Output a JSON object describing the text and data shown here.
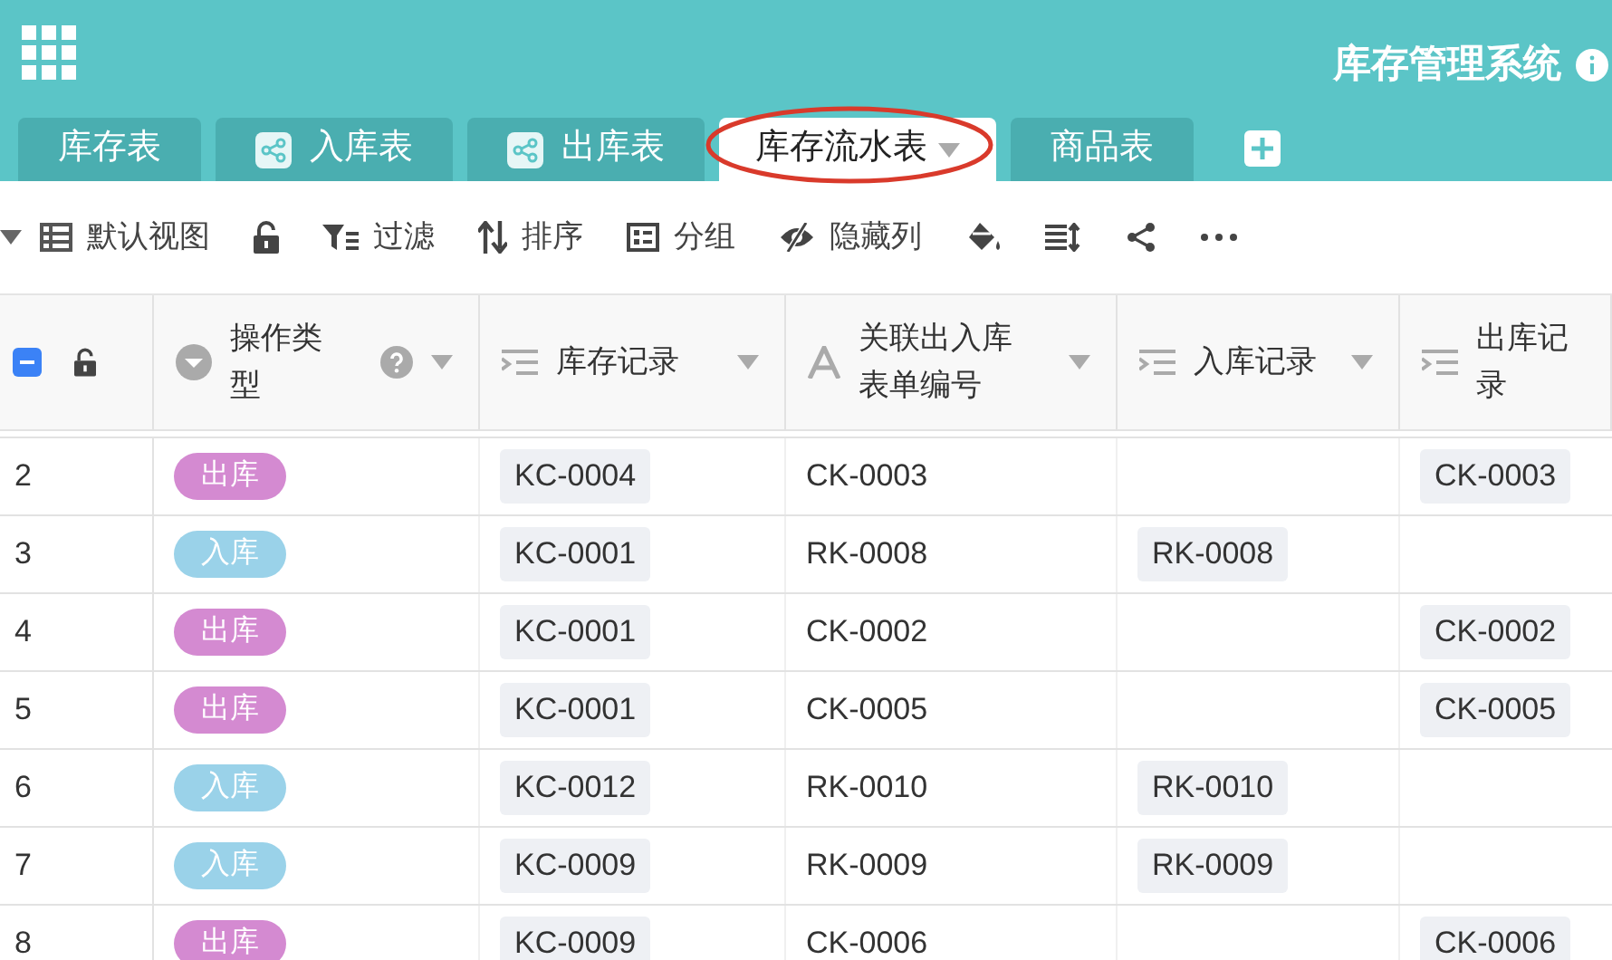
{
  "app": {
    "title": "库存管理系统"
  },
  "tabs": [
    {
      "label": "库存表",
      "linked": false,
      "selected": false
    },
    {
      "label": "入库表",
      "linked": true,
      "selected": false
    },
    {
      "label": "出库表",
      "linked": true,
      "selected": false
    },
    {
      "label": "库存流水表",
      "linked": false,
      "selected": true
    },
    {
      "label": "商品表",
      "linked": false,
      "selected": false
    }
  ],
  "toolbar": [
    {
      "kind": "view",
      "label": "默认视图"
    },
    {
      "kind": "lock"
    },
    {
      "kind": "filter",
      "label": "过滤"
    },
    {
      "kind": "sort",
      "label": "排序"
    },
    {
      "kind": "group",
      "label": "分组"
    },
    {
      "kind": "hide",
      "label": "隐藏列"
    },
    {
      "kind": "fill"
    },
    {
      "kind": "rowheight"
    },
    {
      "kind": "share"
    },
    {
      "kind": "more"
    }
  ],
  "select_all": {
    "indeterminate": true
  },
  "columns": [
    {
      "label": "操作类型",
      "kind": "select",
      "help": true
    },
    {
      "label": "库存记录",
      "kind": "link",
      "help": false
    },
    {
      "label": "关联出入库表单编号",
      "kind": "text",
      "help": false
    },
    {
      "label": "入库记录",
      "kind": "link",
      "help": false
    },
    {
      "label": "出库记录",
      "kind": "link",
      "help": false
    }
  ],
  "rows": [
    {
      "index": "2",
      "type": {
        "label": "出库",
        "color": "#d48ad1"
      },
      "stock": "KC-0004",
      "related": "CK-0003",
      "in_record": "",
      "out_record": "CK-0003"
    },
    {
      "index": "3",
      "type": {
        "label": "入库",
        "color": "#9ad2e9"
      },
      "stock": "KC-0001",
      "related": "RK-0008",
      "in_record": "RK-0008",
      "out_record": ""
    },
    {
      "index": "4",
      "type": {
        "label": "出库",
        "color": "#d48ad1"
      },
      "stock": "KC-0001",
      "related": "CK-0002",
      "in_record": "",
      "out_record": "CK-0002"
    },
    {
      "index": "5",
      "type": {
        "label": "出库",
        "color": "#d48ad1"
      },
      "stock": "KC-0001",
      "related": "CK-0005",
      "in_record": "",
      "out_record": "CK-0005"
    },
    {
      "index": "6",
      "type": {
        "label": "入库",
        "color": "#9ad2e9"
      },
      "stock": "KC-0012",
      "related": "RK-0010",
      "in_record": "RK-0010",
      "out_record": ""
    },
    {
      "index": "7",
      "type": {
        "label": "入库",
        "color": "#9ad2e9"
      },
      "stock": "KC-0009",
      "related": "RK-0009",
      "in_record": "RK-0009",
      "out_record": ""
    },
    {
      "index": "8",
      "type": {
        "label": "出库",
        "color": "#d48ad1"
      },
      "stock": "KC-0009",
      "related": "CK-0006",
      "in_record": "",
      "out_record": "CK-0006"
    }
  ]
}
